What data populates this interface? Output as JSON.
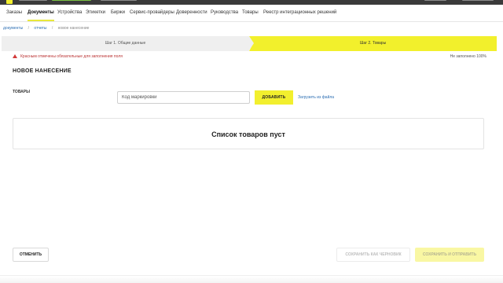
{
  "nav": {
    "items": [
      {
        "label": "Заказы",
        "active": false
      },
      {
        "label": "Документы",
        "active": true
      },
      {
        "label": "Устройства",
        "active": false
      },
      {
        "label": "Этикетки",
        "active": false
      },
      {
        "label": "Биржи",
        "active": false
      },
      {
        "label": "Сервис-провайдеры",
        "active": false
      },
      {
        "label": "Доверенности",
        "active": false
      },
      {
        "label": "Руководства",
        "active": false
      },
      {
        "label": "Товары",
        "active": false
      },
      {
        "label": "Реестр интеграционных решений",
        "active": false
      }
    ]
  },
  "breadcrumb": {
    "items": [
      "документы",
      "отчеты",
      "новое нанесение"
    ]
  },
  "steps": {
    "step1": "Шаг 1. Общие данные",
    "step2": "Шаг 2. Товары",
    "active_color": "#f2f02c"
  },
  "notice": {
    "required_text": "Красным отмечены обязательные для заполнения поля",
    "filled_text": "Не заполнено 100%"
  },
  "form": {
    "title": "НОВОЕ НАНЕСЕНИЕ",
    "goods_label": "ТОВАРЫ",
    "code_placeholder": "Код маркировки",
    "add_button": "ДОБАВИТЬ",
    "upload_link": "Загрузить из файла",
    "empty_list": "Список товаров пуст"
  },
  "footer": {
    "cancel_button": "ОТМЕНИТЬ",
    "draft_button": "СОХРАНИТЬ КАК ЧЕРНОВИК",
    "send_button": "СОХРАНИТЬ И ОТПРАВИТЬ"
  },
  "colors": {
    "accent": "#f2ef2e",
    "link": "#2d6fb3",
    "error": "#d23a3a"
  }
}
